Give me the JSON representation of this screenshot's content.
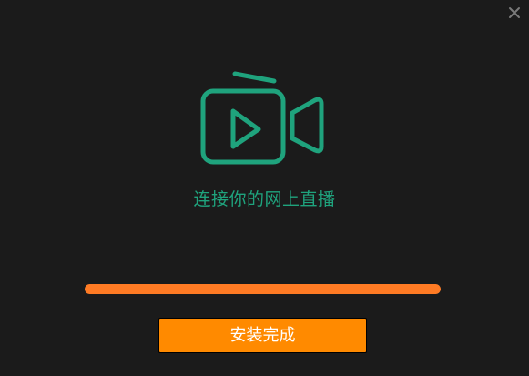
{
  "window": {
    "close_icon": "close-icon"
  },
  "logo": {
    "icon": "video-camera-play-icon",
    "color": "#1fa37d"
  },
  "tagline": "连接你的网上直播",
  "progress": {
    "value": 1.0,
    "color": "#ff7b24"
  },
  "actions": {
    "finish_label": "安装完成",
    "finish_color": "#ff8a00"
  }
}
